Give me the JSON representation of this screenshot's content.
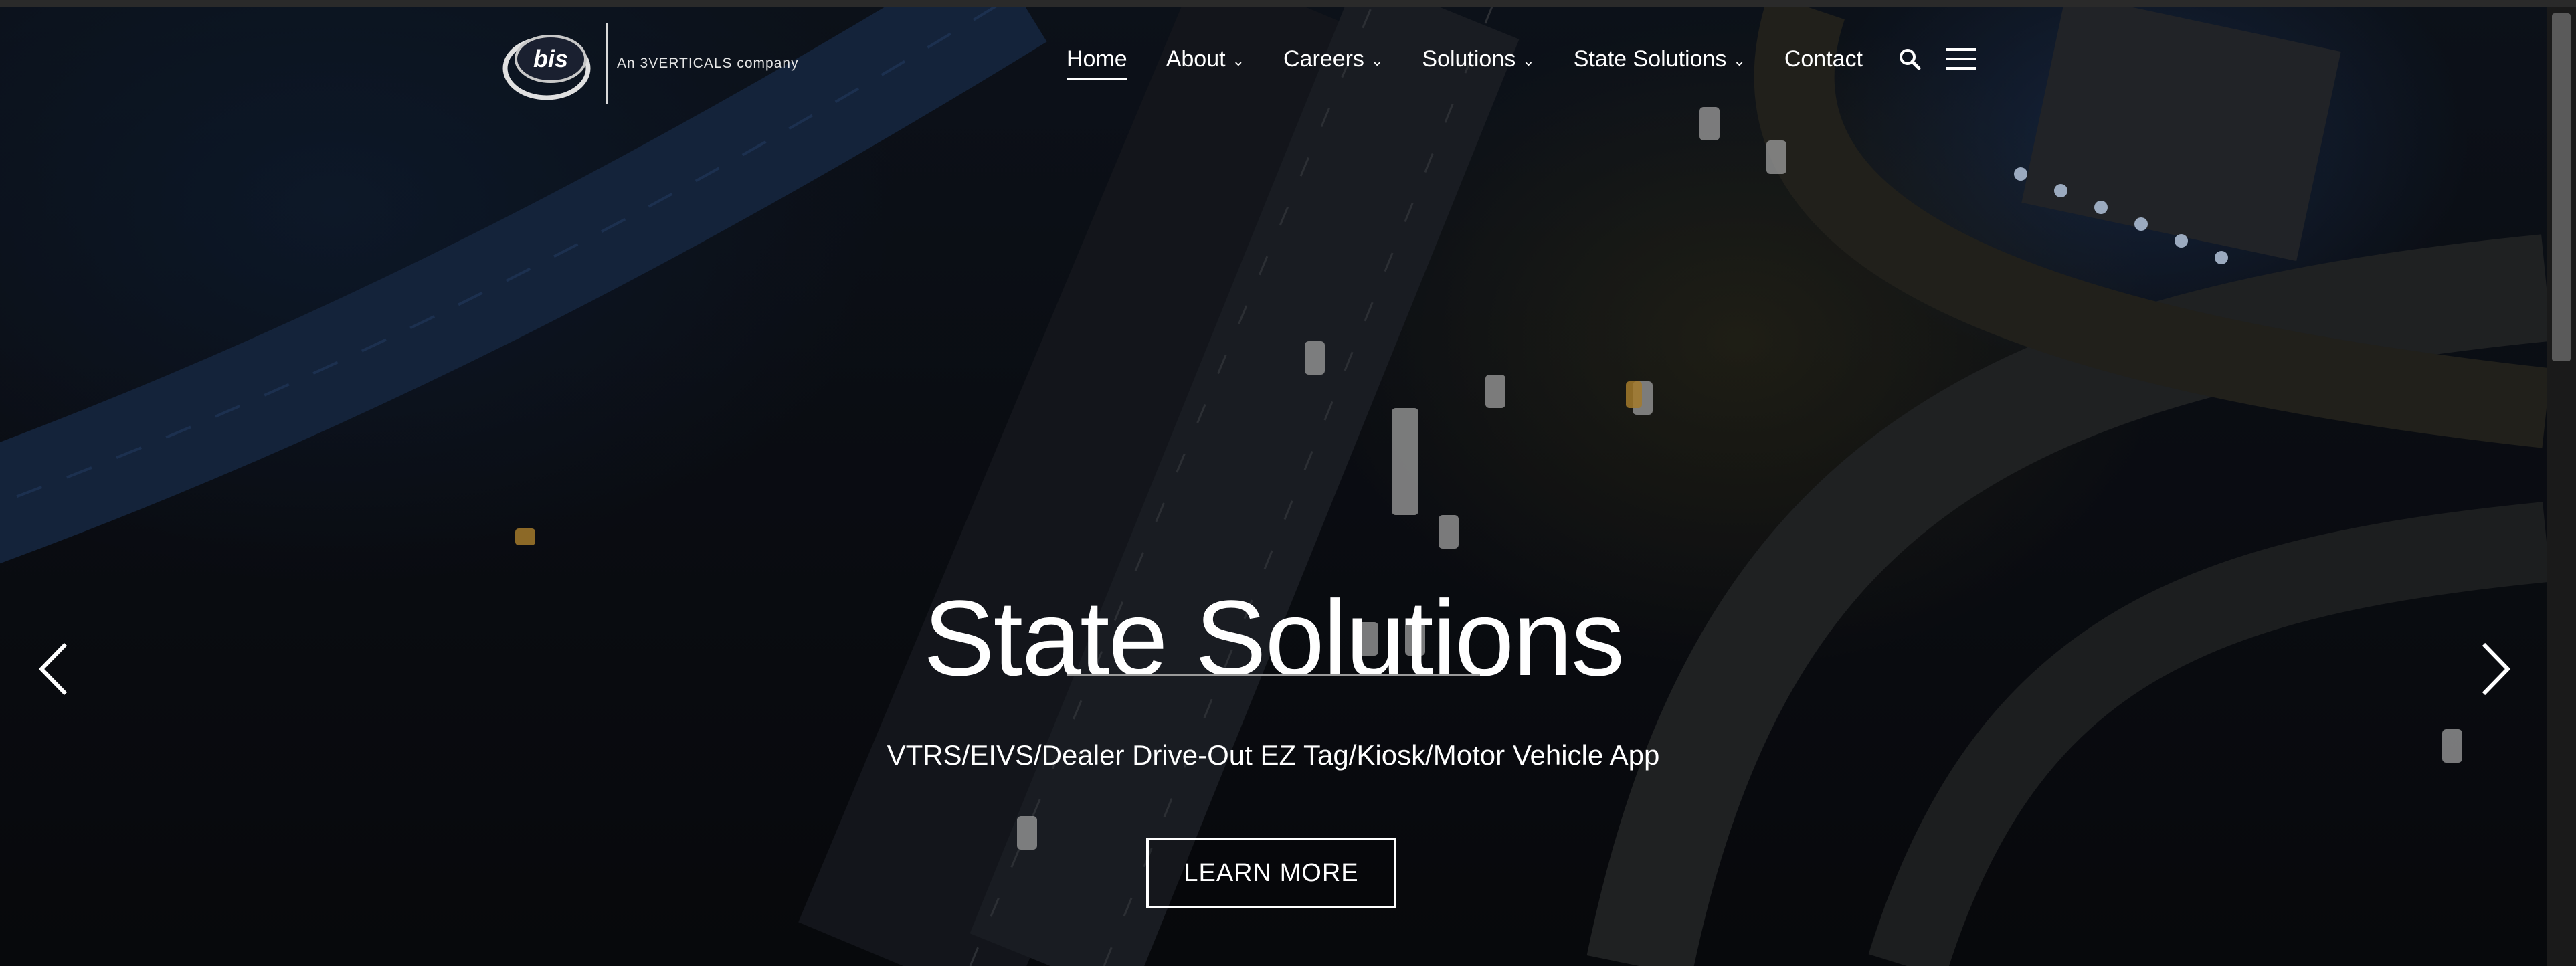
{
  "logo": {
    "mark_text": "bis",
    "tagline": "An 3VERTICALS company"
  },
  "nav": {
    "items": [
      {
        "label": "Home",
        "active": true,
        "dropdown": false
      },
      {
        "label": "About",
        "dropdown": true
      },
      {
        "label": "Careers",
        "dropdown": true
      },
      {
        "label": "Solutions",
        "dropdown": true
      },
      {
        "label": "State Solutions",
        "dropdown": true
      },
      {
        "label": "Contact",
        "dropdown": false
      }
    ],
    "search_icon": "search-icon",
    "menu_icon": "hamburger-menu-icon"
  },
  "slide": {
    "title": "State Solutions",
    "subtitle": "VTRS/EIVS/Dealer Drive-Out EZ Tag/Kiosk/Motor Vehicle App",
    "button_label": "LEARN MORE",
    "prev_icon": "chevron-left-icon",
    "next_icon": "chevron-right-icon"
  },
  "colors": {
    "text": "#ffffff",
    "divider": "#9a9a9a"
  }
}
